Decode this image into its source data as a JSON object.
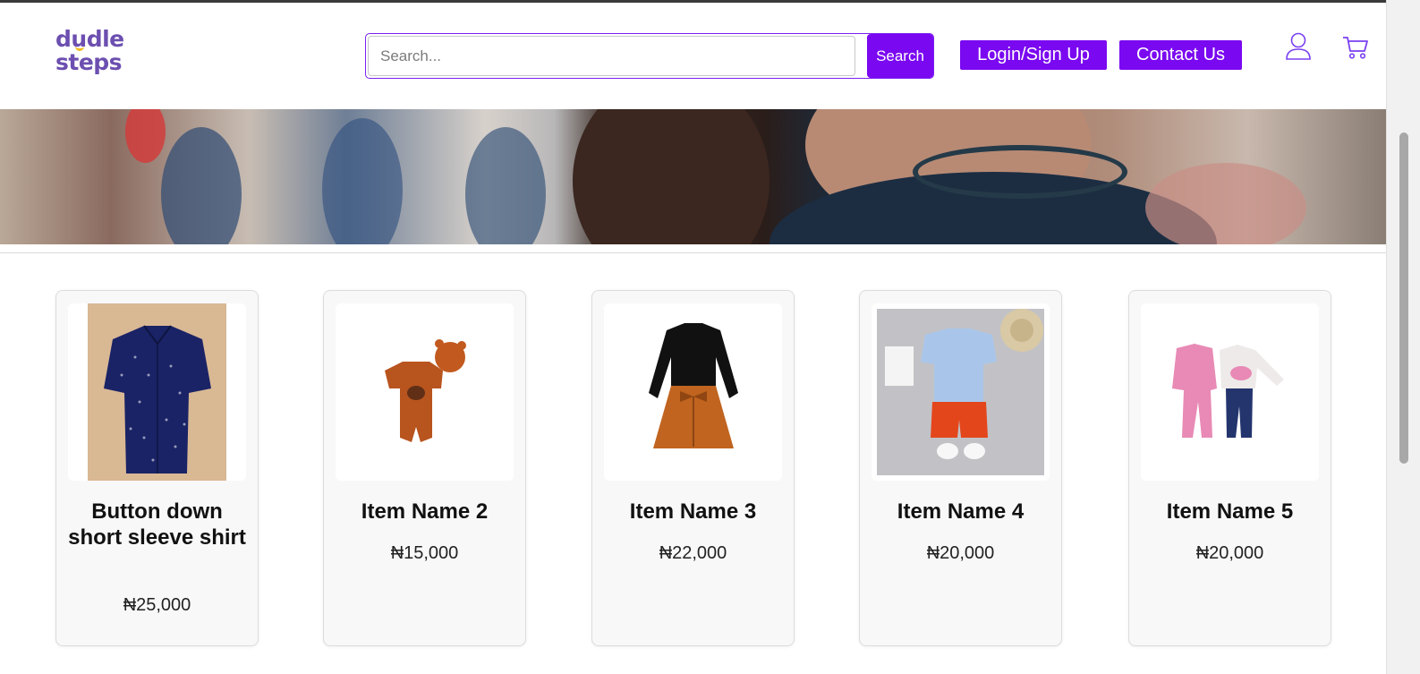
{
  "header": {
    "logo_line1": "dudle",
    "logo_line2": "steps",
    "search_placeholder": "Search...",
    "search_button": "Search",
    "login_button": "Login/Sign Up",
    "contact_button": "Contact Us",
    "accent_color": "#7a08f0",
    "icons": [
      "user-icon",
      "cart-icon"
    ]
  },
  "products": [
    {
      "name": "Button down short sleeve shirt",
      "price": "₦25,000",
      "image": "navy-shirt"
    },
    {
      "name": "Item Name 2",
      "price": "₦15,000",
      "image": "orange-romper"
    },
    {
      "name": "Item Name 3",
      "price": "₦22,000",
      "image": "black-top-rust-skirt"
    },
    {
      "name": "Item Name 4",
      "price": "₦20,000",
      "image": "dino-shirt-shorts-set"
    },
    {
      "name": "Item Name 5",
      "price": "₦20,000",
      "image": "pink-dino-pajamas"
    }
  ]
}
